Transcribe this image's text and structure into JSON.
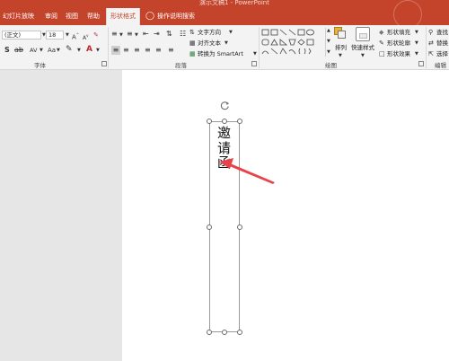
{
  "window": {
    "title": "演示文稿1 - PowerPoint"
  },
  "tabs": [
    {
      "label": "幻灯片放映"
    },
    {
      "label": "审阅"
    },
    {
      "label": "视图"
    },
    {
      "label": "帮助"
    },
    {
      "label": "形状格式"
    }
  ],
  "tell_me": {
    "label": "操作说明搜索"
  },
  "font_group": {
    "font_name": "(正文)",
    "font_size": "18",
    "label": "字体"
  },
  "paragraph_group": {
    "text_direction": "文字方向",
    "align_text": "对齐文本",
    "convert_smartart": "转换为 SmartArt",
    "label": "段落"
  },
  "drawing_group": {
    "arrange": "排列",
    "quick_styles": "快速样式",
    "shape_fill": "形状填充",
    "shape_outline": "形状轮廓",
    "shape_effects": "形状效果",
    "label": "绘图"
  },
  "editing_group": {
    "find": "查找",
    "replace": "替换",
    "select": "选择",
    "label": "编辑"
  },
  "slide": {
    "textbox_chars": [
      "邀",
      "请",
      "函"
    ]
  },
  "colors": {
    "accent": "#c4442b",
    "arrow": "#e8424a"
  }
}
